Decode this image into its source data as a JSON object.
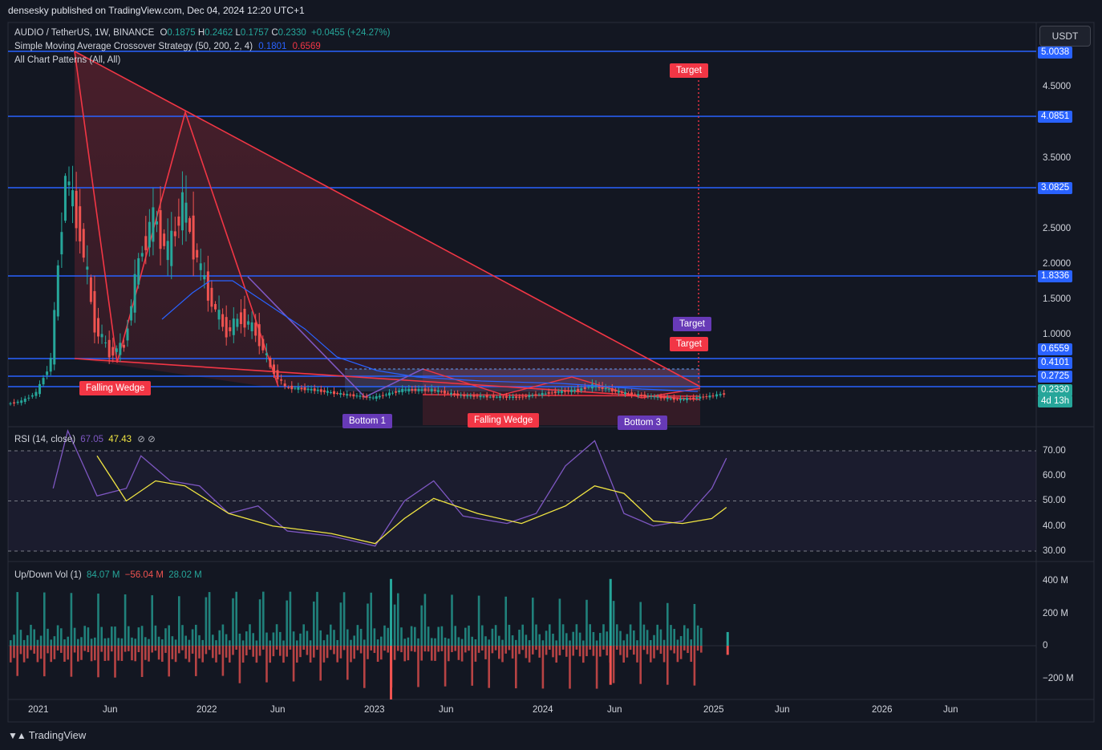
{
  "publisher_line": "densesky published on TradingView.com, Dec 04, 2024 12:20 UTC+1",
  "symbol": {
    "name": "AUDIO / TetherUS, 1W, BINANCE",
    "o_label": "O",
    "o": "0.1875",
    "h_label": "H",
    "h": "0.2462",
    "l_label": "L",
    "l": "0.1757",
    "c_label": "C",
    "c": "0.2330",
    "change": "+0.0455 (+24.27%)"
  },
  "indicators": {
    "sma_label": "Simple Moving Average Crossover Strategy (50, 200, 2, 4)",
    "sma_v1": "0.1801",
    "sma_v2": "0.6569",
    "patterns_label": "All Chart Patterns (All, All)",
    "rsi_label": "RSI (14, close)",
    "rsi_v1": "67.05",
    "rsi_v2": "47.43",
    "vol_label": "Up/Down Vol (1)",
    "vol_up": "84.07 M",
    "vol_down": "−56.04 M",
    "vol_delta": "28.02 M"
  },
  "currency_button": "USDT",
  "colors": {
    "background": "#131722",
    "up": "#26a69a",
    "down": "#ef5350",
    "pattern": "#f23645",
    "hline": "#2962ff",
    "rsi": "#7e57c2",
    "rsi_ma": "#f0e442"
  },
  "price_axis": {
    "ticks": [
      "4.5000",
      "3.5000",
      "2.5000",
      "2.0000",
      "1.5000",
      "1.0000"
    ],
    "price_tags": [
      "5.0038",
      "4.0851",
      "3.0825",
      "1.8336",
      "0.6559",
      "0.4101",
      "0.2725"
    ],
    "last_price": "0.2330",
    "countdown": "4d 13h"
  },
  "rsi_axis": [
    "70.00",
    "60.00",
    "50.00",
    "40.00",
    "30.00"
  ],
  "vol_axis": [
    "400 M",
    "200 M",
    "0",
    "−200 M"
  ],
  "time_axis": [
    "2021",
    "Jun",
    "2022",
    "Jun",
    "2023",
    "Jun",
    "2024",
    "Jun",
    "2025",
    "Jun",
    "2026",
    "Jun"
  ],
  "annotations": {
    "target_1": "Target",
    "target_2": "Target",
    "target_3": "Target",
    "falling_wedge_1": "Falling Wedge",
    "falling_wedge_2": "Falling Wedge",
    "bottom_1": "Bottom 1",
    "bottom_3": "Bottom 3"
  },
  "footer_brand": "TradingView",
  "chart_data": {
    "type": "candlestick",
    "symbol": "AUDIO / TetherUS",
    "interval": "1W",
    "horizontal_levels": [
      5.0038,
      4.0851,
      3.0825,
      1.8336,
      0.6559,
      0.4101,
      0.2725
    ],
    "price_path": [
      {
        "x": "2020-11",
        "y": 0.05
      },
      {
        "x": "2020-12",
        "y": 0.1
      },
      {
        "x": "2021-01",
        "y": 0.25
      },
      {
        "x": "2021-02",
        "y": 0.8
      },
      {
        "x": "2021-03",
        "y": 3.4
      },
      {
        "x": "2021-04",
        "y": 2.6
      },
      {
        "x": "2021-05",
        "y": 1.3
      },
      {
        "x": "2021-06",
        "y": 0.9
      },
      {
        "x": "2021-07",
        "y": 1.0
      },
      {
        "x": "2021-08",
        "y": 2.2
      },
      {
        "x": "2021-09",
        "y": 2.8
      },
      {
        "x": "2021-10",
        "y": 2.3
      },
      {
        "x": "2021-11",
        "y": 3.0
      },
      {
        "x": "2021-12",
        "y": 2.2
      },
      {
        "x": "2022-01",
        "y": 1.6
      },
      {
        "x": "2022-02",
        "y": 1.2
      },
      {
        "x": "2022-03",
        "y": 1.4
      },
      {
        "x": "2022-04",
        "y": 1.2
      },
      {
        "x": "2022-05",
        "y": 0.7
      },
      {
        "x": "2022-06",
        "y": 0.35
      },
      {
        "x": "2022-08",
        "y": 0.3
      },
      {
        "x": "2022-10",
        "y": 0.22
      },
      {
        "x": "2022-12",
        "y": 0.16
      },
      {
        "x": "2023-02",
        "y": 0.3
      },
      {
        "x": "2023-04",
        "y": 0.3
      },
      {
        "x": "2023-06",
        "y": 0.2
      },
      {
        "x": "2023-08",
        "y": 0.18
      },
      {
        "x": "2023-10",
        "y": 0.17
      },
      {
        "x": "2023-12",
        "y": 0.25
      },
      {
        "x": "2024-02",
        "y": 0.3
      },
      {
        "x": "2024-03",
        "y": 0.38
      },
      {
        "x": "2024-05",
        "y": 0.25
      },
      {
        "x": "2024-07",
        "y": 0.18
      },
      {
        "x": "2024-09",
        "y": 0.13
      },
      {
        "x": "2024-11",
        "y": 0.19
      },
      {
        "x": "2024-12",
        "y": 0.233
      }
    ],
    "rsi": {
      "ylim": [
        30,
        70
      ],
      "levels": [
        70,
        50,
        30
      ],
      "series": [
        {
          "x": "2021-02",
          "y": 55
        },
        {
          "x": "2021-03",
          "y": 78
        },
        {
          "x": "2021-05",
          "y": 52
        },
        {
          "x": "2021-07",
          "y": 55
        },
        {
          "x": "2021-08",
          "y": 68
        },
        {
          "x": "2021-10",
          "y": 58
        },
        {
          "x": "2021-12",
          "y": 56
        },
        {
          "x": "2022-02",
          "y": 45
        },
        {
          "x": "2022-04",
          "y": 48
        },
        {
          "x": "2022-06",
          "y": 38
        },
        {
          "x": "2022-09",
          "y": 36
        },
        {
          "x": "2022-12",
          "y": 32
        },
        {
          "x": "2023-02",
          "y": 50
        },
        {
          "x": "2023-04",
          "y": 58
        },
        {
          "x": "2023-06",
          "y": 44
        },
        {
          "x": "2023-09",
          "y": 41
        },
        {
          "x": "2023-11",
          "y": 45
        },
        {
          "x": "2024-01",
          "y": 64
        },
        {
          "x": "2024-03",
          "y": 74
        },
        {
          "x": "2024-05",
          "y": 45
        },
        {
          "x": "2024-07",
          "y": 40
        },
        {
          "x": "2024-09",
          "y": 42
        },
        {
          "x": "2024-11",
          "y": 55
        },
        {
          "x": "2024-12",
          "y": 67.05
        }
      ],
      "ma": [
        {
          "x": "2021-05",
          "y": 68
        },
        {
          "x": "2021-07",
          "y": 50
        },
        {
          "x": "2021-09",
          "y": 58
        },
        {
          "x": "2021-11",
          "y": 56
        },
        {
          "x": "2022-02",
          "y": 45
        },
        {
          "x": "2022-05",
          "y": 40
        },
        {
          "x": "2022-09",
          "y": 37
        },
        {
          "x": "2022-12",
          "y": 33
        },
        {
          "x": "2023-02",
          "y": 43
        },
        {
          "x": "2023-04",
          "y": 51
        },
        {
          "x": "2023-07",
          "y": 45
        },
        {
          "x": "2023-10",
          "y": 41
        },
        {
          "x": "2024-01",
          "y": 48
        },
        {
          "x": "2024-03",
          "y": 56
        },
        {
          "x": "2024-05",
          "y": 53
        },
        {
          "x": "2024-07",
          "y": 42
        },
        {
          "x": "2024-09",
          "y": 41
        },
        {
          "x": "2024-11",
          "y": 43
        },
        {
          "x": "2024-12",
          "y": 47.43
        }
      ]
    },
    "volume": {
      "ylim": [
        -200,
        400
      ],
      "unit": "M",
      "notable_bars": [
        {
          "x": "2023-01",
          "up": 410,
          "down": -330
        },
        {
          "x": "2024-04",
          "up": 410,
          "down": -240
        },
        {
          "x": "2024-12",
          "up": 84.07,
          "down": -56.04
        }
      ]
    }
  }
}
